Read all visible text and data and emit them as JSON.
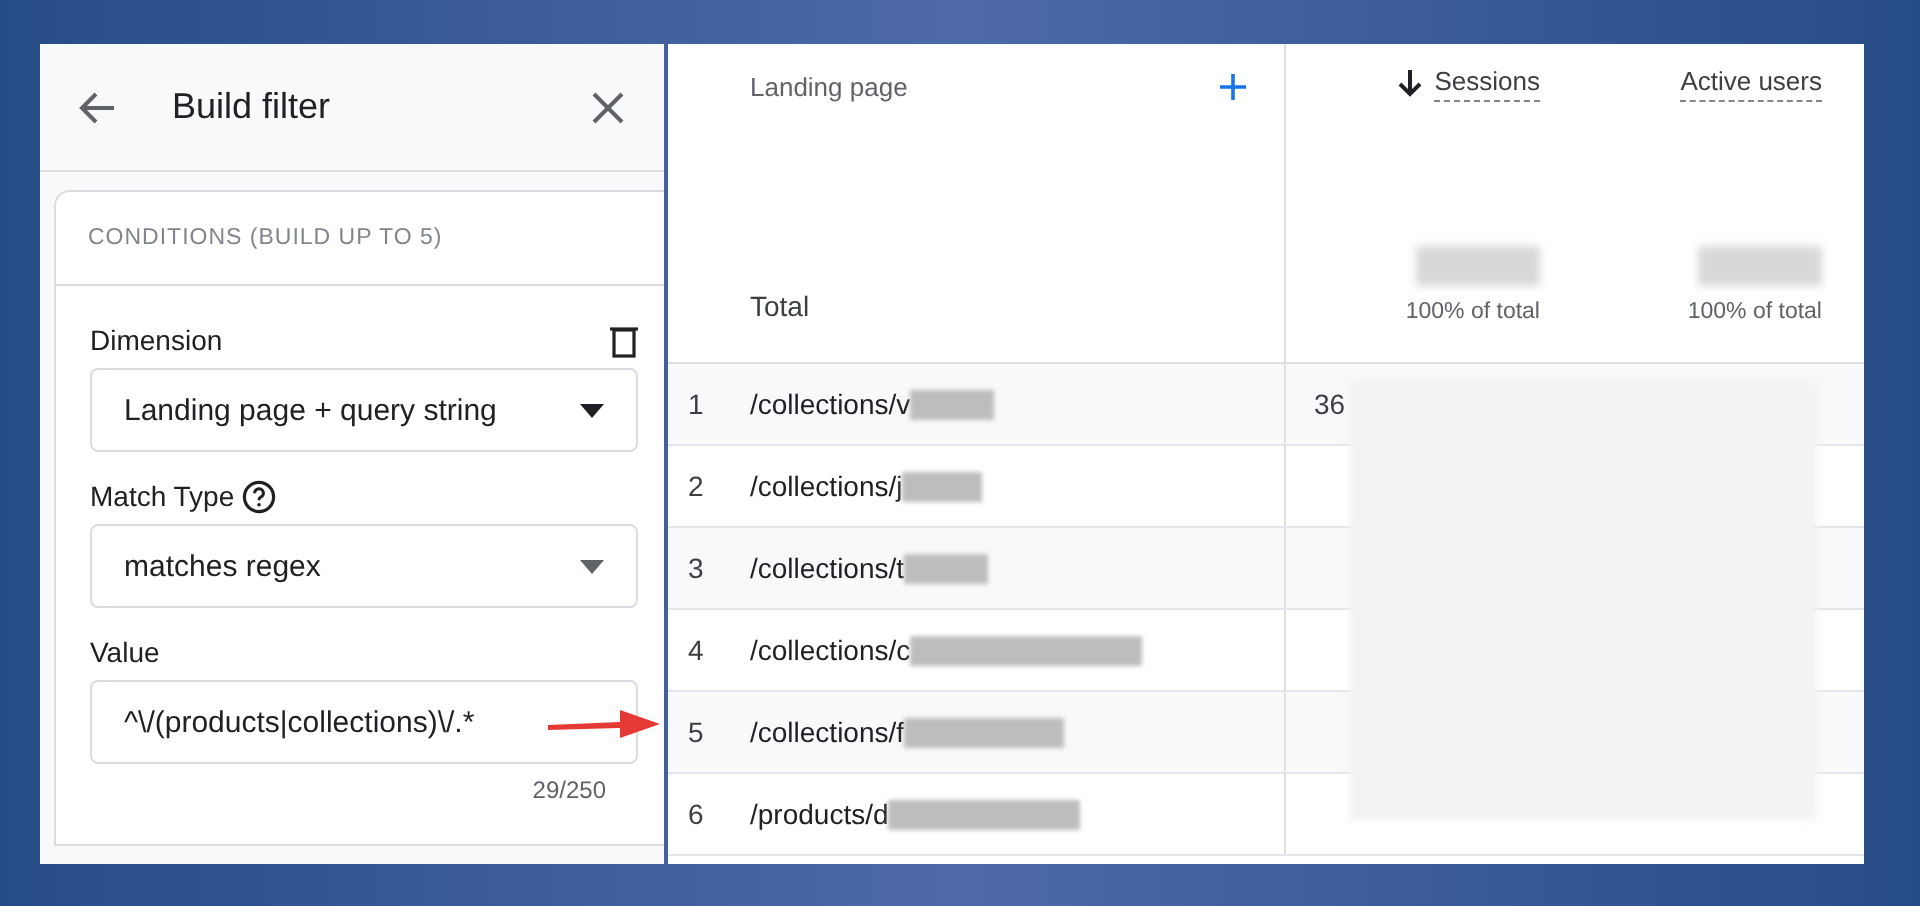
{
  "filter_panel": {
    "title": "Build filter",
    "conditions_heading": "CONDITIONS (BUILD UP TO 5)",
    "fields": [
      {
        "kind": "select",
        "label": "Dimension",
        "value": "Landing page + query string",
        "deletable": true,
        "help": false
      },
      {
        "kind": "select",
        "label": "Match Type",
        "value": "matches regex",
        "deletable": false,
        "help": true
      },
      {
        "kind": "text",
        "label": "Value",
        "value": "^\\/(products|collections)\\/.*",
        "counter": "29/250",
        "deletable": false,
        "help": false
      }
    ]
  },
  "table": {
    "columns": [
      {
        "label": "Landing page",
        "kind": "dimension"
      },
      {
        "label": "Sessions",
        "kind": "metric",
        "sorted": true,
        "total_share": "100% of total"
      },
      {
        "label": "Active users",
        "kind": "metric",
        "sorted": false,
        "total_share": "100% of total"
      }
    ],
    "total_label": "Total",
    "rows": [
      {
        "index": "1",
        "page": "/collections/v",
        "sessions": "36"
      },
      {
        "index": "2",
        "page": "/collections/j"
      },
      {
        "index": "3",
        "page": "/collections/t"
      },
      {
        "index": "4",
        "page": "/collections/c"
      },
      {
        "index": "5",
        "page": "/collections/f"
      },
      {
        "index": "6",
        "page": "/products/d"
      }
    ]
  }
}
